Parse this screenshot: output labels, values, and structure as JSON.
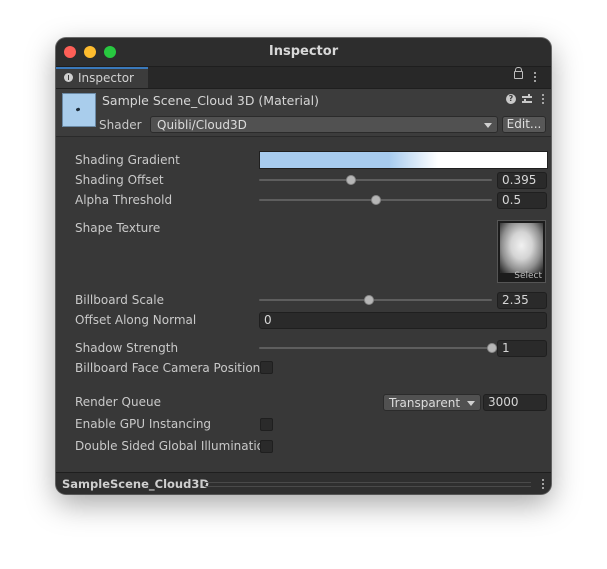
{
  "window": {
    "title": "Inspector"
  },
  "tab": {
    "label": "Inspector"
  },
  "material": {
    "name": "Sample Scene_Cloud 3D (Material)",
    "shader_label": "Shader",
    "shader_value": "Quibli/Cloud3D",
    "edit_label": "Edit...",
    "thumbnail_color": "#a9cdec"
  },
  "properties": {
    "shading_gradient": {
      "label": "Shading Gradient",
      "colors": [
        "#a7cbee",
        "#ffffff"
      ]
    },
    "shading_offset": {
      "label": "Shading Offset",
      "value": "0.395",
      "fraction": 0.395
    },
    "alpha_threshold": {
      "label": "Alpha Threshold",
      "value": "0.5",
      "fraction": 0.5
    },
    "shape_texture": {
      "label": "Shape Texture",
      "select_label": "Select"
    },
    "billboard_scale": {
      "label": "Billboard Scale",
      "value": "2.35"
    },
    "offset_along_normal": {
      "label": "Offset Along Normal",
      "value": "0"
    },
    "shadow_strength": {
      "label": "Shadow Strength",
      "value": "1",
      "fraction": 1
    },
    "billboard_face_camera": {
      "label": "Billboard Face Camera Position",
      "checked": false
    },
    "render_queue": {
      "label": "Render Queue",
      "mode": "Transparent",
      "value": "3000"
    },
    "gpu_instancing": {
      "label": "Enable GPU Instancing",
      "checked": false
    },
    "double_sided_gi": {
      "label": "Double Sided Global Illumination",
      "checked": false
    }
  },
  "footer": {
    "title": "SampleScene_Cloud3D"
  },
  "icons": {
    "window": [
      "close-icon",
      "minimize-icon",
      "maximize-icon"
    ],
    "tab": "info-icon",
    "tabbar": [
      "lock-icon",
      "more-icon"
    ],
    "header": [
      "help-icon",
      "preset-icon",
      "more-icon"
    ],
    "footer": "more-icon"
  }
}
